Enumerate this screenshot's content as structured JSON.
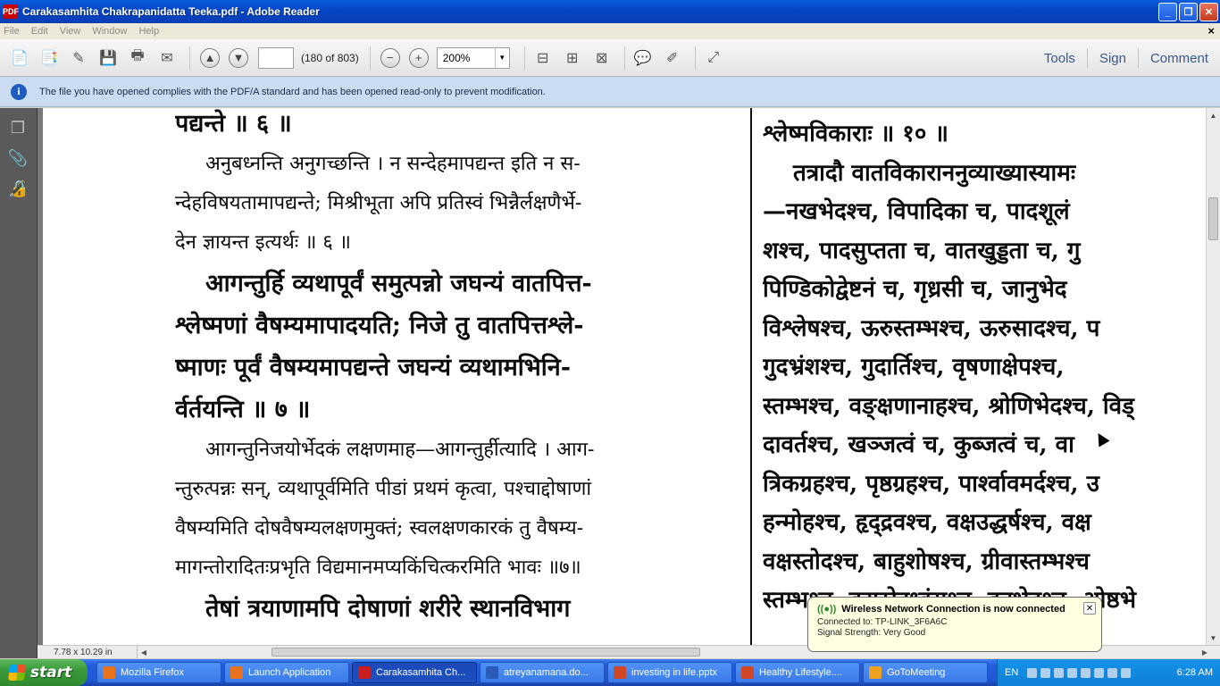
{
  "window": {
    "title": "Carakasamhita Chakrapanidatta Teeka.pdf - Adobe Reader",
    "app_icon": "PDF"
  },
  "menu": [
    "File",
    "Edit",
    "View",
    "Window",
    "Help"
  ],
  "toolbar": {
    "page_value": "",
    "page_count": "(180 of 803)",
    "zoom": "200%",
    "links": [
      "Tools",
      "Sign",
      "Comment"
    ]
  },
  "infobar": {
    "text": "The file you have opened complies with the PDF/A standard and has been opened read-only to prevent modification."
  },
  "document": {
    "left_lines": [
      {
        "text": "पद्यन्ते ॥ ६ ॥",
        "style": "lg"
      },
      {
        "text": "अनुबध्नन्ति अनुगच्छन्ति । न सन्देहमापद्यन्त इति न स-",
        "style": "sm ind"
      },
      {
        "text": "न्देहविषयतामापद्यन्ते; मिश्रीभूता अपि प्रतिस्वं भिन्नैर्लक्षणैर्भे-",
        "style": "sm"
      },
      {
        "text": "देन ज्ञायन्त इत्यर्थः ॥ ६ ॥",
        "style": "sm"
      },
      {
        "text": "आगन्तुर्हि व्यथापूर्वं समुत्पन्नो जघन्यं वातपित्त-",
        "style": "lg ind"
      },
      {
        "text": "श्लेष्मणां वैषम्यमापादयति; निजे तु वातपित्तश्ले-",
        "style": "lg"
      },
      {
        "text": "ष्माणः पूर्वं वैषम्यमापद्यन्ते जघन्यं व्यथामभिनि-",
        "style": "lg"
      },
      {
        "text": "र्वर्तयन्ति ॥ ७ ॥",
        "style": "lg"
      },
      {
        "text": "आगन्तुनिजयोर्भेदकं लक्षणमाह—आगन्तुर्हीत्यादि । आग-",
        "style": "sm ind"
      },
      {
        "text": "न्तुरुत्पन्नः सन्, व्यथापूर्वमिति पीडां प्रथमं कृत्वा, पश्चाद्दोषाणां",
        "style": "sm"
      },
      {
        "text": "वैषम्यमिति दोषवैषम्यलक्षणमुक्तं; स्वलक्षणकारकं तु वैषम्य-",
        "style": "sm"
      },
      {
        "text": "मागन्तोरादितःप्रभृति विद्यमानमप्यकिंचित्करमिति भावः ॥७॥",
        "style": "sm"
      },
      {
        "text": "तेषां त्रयाणामपि दोषाणां शरीरे स्थानविभाग",
        "style": "lg ind"
      }
    ],
    "right_lines": [
      "श्लेष्मविकाराः ॥ १० ॥",
      "तत्रादौ वातविकाराननुव्याख्यास्यामः",
      "—नखभेदश्च, विपादिका च, पादशूलं",
      "शश्च, पादसुप्तता च, वातखुड्डता च, गु",
      "पिण्डिकोद्वेष्टनं च, गृध्रसी च, जानुभेद",
      "विश्लेषश्च, ऊरुस्तम्भश्च, ऊरुसादश्च, प",
      "गुदभ्रंशश्च, गुदार्तिश्च, वृषणाक्षेपश्च,",
      "स्तम्भश्च, वङ्क्षणानाहश्च, श्रोणिभेदश्च, विड्",
      "दावर्तश्च, खञ्जत्वं च, कुब्जत्वं च, वा",
      "त्रिकग्रहश्च, पृष्ठग्रहश्च, पार्श्वावमर्दश्च, उ",
      "हन्मोहश्च, हृद्द्रवश्च, वक्षउद्धर्षश्च, वक्ष",
      "वक्षस्तोदश्च, बाहुशोषश्च, ग्रीवास्तम्भश्च",
      "स्तम्भश्च, कण्ठोद्ध्वंसश्च, हनुभेदश्च, ओष्ठभे"
    ]
  },
  "statusbar": {
    "page_size": "7.78 x 10.29 in"
  },
  "balloon": {
    "title": "Wireless Network Connection is now connected",
    "line1": "Connected to: TP-LINK_3F6A6C",
    "line2": "Signal Strength: Very Good"
  },
  "taskbar": {
    "start": "start",
    "tasks": [
      {
        "label": "Mozilla Firefox",
        "color": "#e8731c",
        "active": false
      },
      {
        "label": "Launch Application",
        "color": "#e8731c",
        "active": false
      },
      {
        "label": "Carakasamhita Ch...",
        "color": "#c81e1e",
        "active": true
      },
      {
        "label": "atreyanamana.do...",
        "color": "#2a5bb8",
        "active": false
      },
      {
        "label": "investing in life.pptx",
        "color": "#d24726",
        "active": false
      },
      {
        "label": "Healthy Lifestyle....",
        "color": "#d24726",
        "active": false
      },
      {
        "label": "GoToMeeting",
        "color": "#f0a020",
        "active": false
      }
    ],
    "lang": "EN",
    "clock": "6:28 AM"
  }
}
